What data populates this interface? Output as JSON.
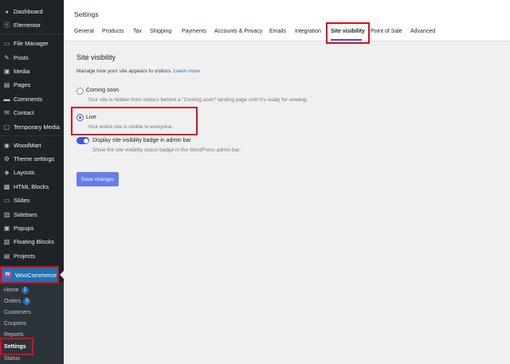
{
  "sidebar": {
    "items": [
      {
        "label": "Dashboard",
        "icon": "dashboard-icon",
        "glyph": "◕"
      },
      {
        "label": "Elementor",
        "icon": "elementor-icon",
        "glyph": "ⓔ"
      },
      {
        "label": "File Manager",
        "icon": "file-manager-icon",
        "glyph": "▭"
      },
      {
        "label": "Posts",
        "icon": "pin-icon",
        "glyph": "✎"
      },
      {
        "label": "Media",
        "icon": "media-icon",
        "glyph": "▣"
      },
      {
        "label": "Pages",
        "icon": "pages-icon",
        "glyph": "▤"
      },
      {
        "label": "Comments",
        "icon": "comments-icon",
        "glyph": "▬"
      },
      {
        "label": "Contact",
        "icon": "contact-icon",
        "glyph": "✉"
      },
      {
        "label": "Temporary Media",
        "icon": "temporary-media-icon",
        "glyph": "▢"
      },
      {
        "label": "WoodMart",
        "icon": "woodmart-icon",
        "glyph": "◉"
      },
      {
        "label": "Theme settings",
        "icon": "theme-settings-icon",
        "glyph": "⚙"
      },
      {
        "label": "Layouts",
        "icon": "layouts-icon",
        "glyph": "◈"
      },
      {
        "label": "HTML Blocks",
        "icon": "html-blocks-icon",
        "glyph": "▦"
      },
      {
        "label": "Slides",
        "icon": "slides-icon",
        "glyph": "▭"
      },
      {
        "label": "Sidebars",
        "icon": "sidebars-icon",
        "glyph": "▥"
      },
      {
        "label": "Popups",
        "icon": "popups-icon",
        "glyph": "▣"
      },
      {
        "label": "Floating Blocks",
        "icon": "floating-blocks-icon",
        "glyph": "▧"
      },
      {
        "label": "Projects",
        "icon": "projects-icon",
        "glyph": "▤"
      }
    ],
    "woocommerce_label": "WooCommerce",
    "woocommerce_logo": "W",
    "submenu": [
      {
        "label": "Home",
        "badge": "1"
      },
      {
        "label": "Orders",
        "badge": "3"
      },
      {
        "label": "Customers"
      },
      {
        "label": "Coupons"
      },
      {
        "label": "Reports"
      },
      {
        "label": "Settings"
      },
      {
        "label": "Status"
      }
    ]
  },
  "header": {
    "title": "Settings",
    "tabs": [
      "General",
      "Products",
      "Tax",
      "Shipping",
      "Payments",
      "Accounts & Privacy",
      "Emails",
      "Integration",
      "Site visibility",
      "Point of Sale",
      "Advanced"
    ]
  },
  "main": {
    "section_title": "Site visibility",
    "description": "Manage how your site appears to visitors.",
    "learn_more": "Learn more",
    "options": [
      {
        "label": "Coming soon",
        "help": "Your site is hidden from visitors behind a \"Coming soon\" landing page until it's ready for viewing.",
        "checked": false
      },
      {
        "label": "Live",
        "help": "Your entire site is visible to everyone.",
        "checked": true
      }
    ],
    "badge_toggle": {
      "label": "Display site visibility badge in admin bar",
      "help": "Show the site visibility status badge in the WordPress admin bar.",
      "on": true
    },
    "save_label": "Save changes"
  },
  "colors": {
    "sidebar_bg": "#1d2327",
    "accent": "#3858e9",
    "highlight": "#d10f1f",
    "woo_active": "#2271b1"
  }
}
